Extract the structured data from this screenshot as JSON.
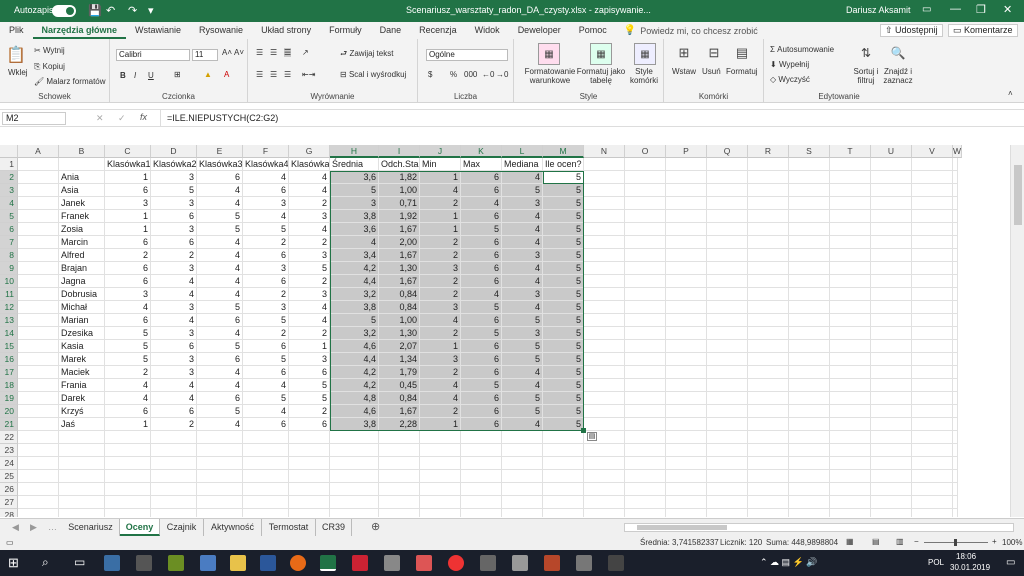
{
  "title_bar": {
    "autosave_label": "Autozapis",
    "autosave_state": "Włączone",
    "file_title": "Scenariusz_warsztaty_radon_DA_czysty.xlsx - zapisywanie...",
    "user_name": "Dariusz Aksamit"
  },
  "menu": {
    "tabs": [
      "Plik",
      "Narzędzia główne",
      "Wstawianie",
      "Rysowanie",
      "Układ strony",
      "Formuły",
      "Dane",
      "Recenzja",
      "Widok",
      "Deweloper",
      "Pomoc"
    ],
    "active_tab": "Narzędzia główne",
    "tell_me": "Powiedz mi, co chcesz zrobić",
    "share": "Udostępnij",
    "comments": "Komentarze"
  },
  "ribbon": {
    "clipboard": {
      "paste": "Wklej",
      "cut": "Wytnij",
      "copy": "Kopiuj",
      "painter": "Malarz formatów",
      "label": "Schowek"
    },
    "font": {
      "name": "Calibri",
      "size": "11",
      "label": "Czcionka",
      "bold": "B",
      "italic": "I",
      "underline": "U"
    },
    "alignment": {
      "wrap": "Zawijaj tekst",
      "merge": "Scal i wyśrodkuj",
      "label": "Wyrównanie"
    },
    "number": {
      "format": "Ogólne",
      "label": "Liczba"
    },
    "styles": {
      "cond": "Formatowanie warunkowe",
      "table": "Formatuj jako tabelę",
      "cell": "Style komórki",
      "label": "Style"
    },
    "cells": {
      "insert": "Wstaw",
      "delete": "Usuń",
      "format": "Formatuj",
      "label": "Komórki"
    },
    "editing": {
      "autosum": "Autosumowanie",
      "fill": "Wypełnij",
      "clear": "Wyczyść",
      "sort": "Sortuj i filtruj",
      "find": "Znajdź i zaznacz",
      "label": "Edytowanie"
    }
  },
  "formula_bar": {
    "name_box": "M2",
    "fx": "fx",
    "formula": "=ILE.NIEPUSTYCH(C2:G2)"
  },
  "sheet": {
    "columns": [
      "A",
      "B",
      "C",
      "D",
      "E",
      "F",
      "G",
      "H",
      "I",
      "J",
      "K",
      "L",
      "M",
      "N",
      "O",
      "P",
      "Q",
      "R",
      "S",
      "T",
      "U",
      "V",
      "W"
    ],
    "selected_columns": [
      "H",
      "I",
      "J",
      "K",
      "L",
      "M"
    ],
    "headers": [
      "",
      "",
      "Klasówka1",
      "Klasówka2",
      "Klasówka3",
      "Klasówka4",
      "Klasówka5",
      "Średnia",
      "Odch.Stand",
      "Min",
      "Max",
      "Mediana",
      "Ile ocen?"
    ],
    "rows": [
      [
        "Ania",
        1,
        3,
        6,
        4,
        4,
        "3,6",
        "1,82",
        1,
        6,
        4,
        5
      ],
      [
        "Asia",
        6,
        5,
        4,
        6,
        4,
        "5",
        "1,00",
        4,
        6,
        5,
        5
      ],
      [
        "Janek",
        3,
        3,
        4,
        3,
        2,
        "3",
        "0,71",
        2,
        4,
        3,
        5
      ],
      [
        "Franek",
        1,
        6,
        5,
        4,
        3,
        "3,8",
        "1,92",
        1,
        6,
        4,
        5
      ],
      [
        "Zosia",
        1,
        3,
        5,
        5,
        4,
        "3,6",
        "1,67",
        1,
        5,
        4,
        5
      ],
      [
        "Marcin",
        6,
        6,
        4,
        2,
        2,
        "4",
        "2,00",
        2,
        6,
        4,
        5
      ],
      [
        "Alfred",
        2,
        2,
        4,
        6,
        3,
        "3,4",
        "1,67",
        2,
        6,
        3,
        5
      ],
      [
        "Brajan",
        6,
        3,
        4,
        3,
        5,
        "4,2",
        "1,30",
        3,
        6,
        4,
        5
      ],
      [
        "Jagna",
        6,
        4,
        4,
        6,
        2,
        "4,4",
        "1,67",
        2,
        6,
        4,
        5
      ],
      [
        "Dobrusia",
        3,
        4,
        4,
        2,
        3,
        "3,2",
        "0,84",
        2,
        4,
        3,
        5
      ],
      [
        "Michał",
        4,
        3,
        5,
        3,
        4,
        "3,8",
        "0,84",
        3,
        5,
        4,
        5
      ],
      [
        "Marian",
        6,
        4,
        6,
        5,
        4,
        "5",
        "1,00",
        4,
        6,
        5,
        5
      ],
      [
        "Dzesika",
        5,
        3,
        4,
        2,
        2,
        "3,2",
        "1,30",
        2,
        5,
        3,
        5
      ],
      [
        "Kasia",
        5,
        6,
        5,
        6,
        1,
        "4,6",
        "2,07",
        1,
        6,
        5,
        5
      ],
      [
        "Marek",
        5,
        3,
        6,
        5,
        3,
        "4,4",
        "1,34",
        3,
        6,
        5,
        5
      ],
      [
        "Maciek",
        2,
        3,
        4,
        6,
        6,
        "4,2",
        "1,79",
        2,
        6,
        4,
        5
      ],
      [
        "Frania",
        4,
        4,
        4,
        4,
        5,
        "4,2",
        "0,45",
        4,
        5,
        4,
        5
      ],
      [
        "Darek",
        4,
        4,
        6,
        5,
        5,
        "4,8",
        "0,84",
        4,
        6,
        5,
        5
      ],
      [
        "Krzyś",
        6,
        6,
        5,
        4,
        2,
        "4,6",
        "1,67",
        2,
        6,
        5,
        5
      ],
      [
        "Jaś",
        1,
        2,
        4,
        6,
        6,
        "3,8",
        "2,28",
        1,
        6,
        4,
        5
      ]
    ],
    "row_numbers": [
      1,
      2,
      3,
      4,
      5,
      6,
      7,
      8,
      9,
      10,
      11,
      12,
      13,
      14,
      15,
      16,
      17,
      18,
      19,
      20,
      21,
      22,
      23,
      24,
      25,
      26,
      27,
      28
    ]
  },
  "sheet_tabs": {
    "items": [
      "Scenariusz",
      "Oceny",
      "Czajnik",
      "Aktywność",
      "Termostat",
      "CR39"
    ],
    "active": "Oceny"
  },
  "status_bar": {
    "avg": "Średnia: 3,741582337",
    "count": "Licznik: 120",
    "sum": "Suma: 448,9898804",
    "zoom": "100%"
  },
  "taskbar": {
    "lang": "POL",
    "time": "18:06",
    "date": "30.01.2019"
  }
}
